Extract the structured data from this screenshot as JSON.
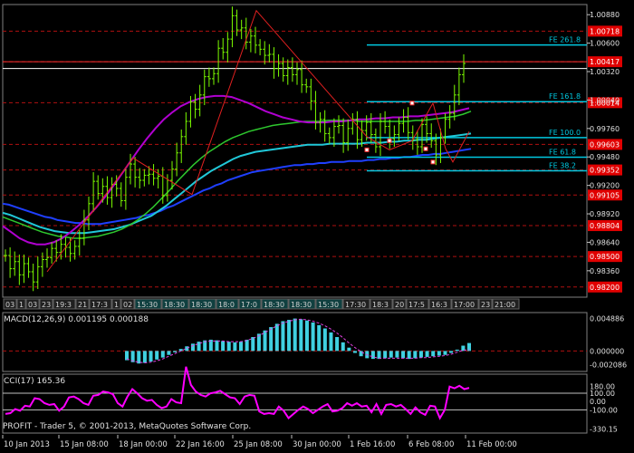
{
  "chart_data": [
    {
      "type": "line",
      "instrument_panel": "price",
      "price_axis_labels": [
        "1.00880",
        "1.00600",
        "1.00320",
        "1.00040",
        "0.99760",
        "0.99480",
        "0.99200",
        "0.98920",
        "0.98640",
        "0.98360"
      ],
      "price_axis_values": [
        1.0088,
        1.006,
        1.0032,
        1.0004,
        0.9976,
        0.9948,
        0.992,
        0.9892,
        0.9864,
        0.9836
      ],
      "ylim": [
        0.981,
        1.0098
      ],
      "level_lines": [
        {
          "label": "1.00718",
          "value": 1.00718
        },
        {
          "label": "1.00417",
          "value": 1.00417
        },
        {
          "label": "1.00014",
          "value": 1.00014
        },
        {
          "label": "0.99603",
          "value": 0.99603
        },
        {
          "label": "0.99352",
          "value": 0.99352
        },
        {
          "label": "0.99105",
          "value": 0.99105
        },
        {
          "label": "0.98804",
          "value": 0.98804
        },
        {
          "label": "0.98500",
          "value": 0.985
        },
        {
          "label": "0.98200",
          "value": 0.982
        }
      ],
      "fibonacci": [
        {
          "label": "FE 261.8",
          "value": 1.00582
        },
        {
          "label": "FE 161.8",
          "value": 1.00024
        },
        {
          "label": "FE 100.0",
          "value": 0.9967
        },
        {
          "label": "FE 61.8",
          "value": 0.99478
        },
        {
          "label": "FE 38.2",
          "value": 0.99344
        }
      ],
      "time_scale_labels": [
        "03",
        "1",
        "03",
        "23",
        "19:3",
        "21",
        "17:3",
        "1",
        "02",
        "15:30",
        "18:30",
        "18:30",
        "18:0",
        "17:0",
        "18:30",
        "18:30",
        "15:30",
        "17:30",
        "18:3",
        "20",
        "17:5",
        "16:3",
        "17:00",
        "23",
        "21:00"
      ],
      "close": [
        0.9851,
        0.9838,
        0.9845,
        0.9832,
        0.9843,
        0.9835,
        0.9825,
        0.984,
        0.9847,
        0.9849,
        0.9858,
        0.9854,
        0.9862,
        0.9859,
        0.9853,
        0.986,
        0.9868,
        0.9886,
        0.9902,
        0.9924,
        0.9912,
        0.9919,
        0.9908,
        0.9921,
        0.9917,
        0.9905,
        0.9928,
        0.9941,
        0.9928,
        0.9925,
        0.993,
        0.9931,
        0.9927,
        0.9929,
        0.991,
        0.9925,
        0.9936,
        0.9952,
        0.9968,
        0.9983,
        1.0002,
        0.9995,
        1.0009,
        1.0027,
        1.0025,
        1.003,
        1.0055,
        1.0051,
        1.0064,
        1.0087,
        1.0073,
        1.0075,
        1.0061,
        1.0067,
        1.0058,
        1.0054,
        1.0048,
        1.0049,
        1.0035,
        1.004,
        1.0028,
        1.0036,
        1.0029,
        1.0034,
        1.0019,
        1.0017,
        1.0003,
        0.9982,
        0.9985,
        0.9971,
        0.9967,
        0.9978,
        0.9979,
        0.9962,
        0.9976,
        0.9985,
        0.9965,
        0.9974,
        0.9982,
        0.997,
        0.9958,
        0.9983,
        0.9978,
        0.9966,
        0.997,
        0.9981,
        0.9987,
        0.9972,
        0.9965,
        0.9958,
        0.998,
        0.9971,
        0.9964,
        0.995,
        0.9967,
        0.9985,
        0.9991,
        1.0009,
        1.0029,
        1.004
      ],
      "ma_blue": [
        0.9902,
        0.9901,
        0.9899,
        0.9897,
        0.9895,
        0.9893,
        0.9891,
        0.9889,
        0.9888,
        0.9886,
        0.9885,
        0.9884,
        0.9883,
        0.9883,
        0.9882,
        0.9882,
        0.9882,
        0.9883,
        0.9884,
        0.9885,
        0.9886,
        0.9887,
        0.9888,
        0.989,
        0.9891,
        0.9893,
        0.9895,
        0.9898,
        0.99,
        0.9903,
        0.9906,
        0.9909,
        0.9912,
        0.9915,
        0.9917,
        0.992,
        0.9922,
        0.9925,
        0.9927,
        0.9929,
        0.9931,
        0.9933,
        0.9934,
        0.9935,
        0.9936,
        0.9937,
        0.9938,
        0.9939,
        0.994,
        0.994,
        0.9941,
        0.9941,
        0.9942,
        0.9942,
        0.9943,
        0.9943,
        0.9943,
        0.9944,
        0.9944,
        0.9944,
        0.9945,
        0.9945,
        0.9946,
        0.9946,
        0.9947,
        0.9947,
        0.9948,
        0.9948,
        0.9949,
        0.995,
        0.995,
        0.9951,
        0.9951,
        0.9952,
        0.9953,
        0.9954,
        0.9955,
        0.9956
      ],
      "ma_cyan": [
        0.9893,
        0.9891,
        0.9888,
        0.9885,
        0.9882,
        0.9879,
        0.9877,
        0.9875,
        0.9874,
        0.9873,
        0.9873,
        0.9873,
        0.9874,
        0.9875,
        0.9876,
        0.9877,
        0.9879,
        0.9881,
        0.9884,
        0.9887,
        0.989,
        0.9895,
        0.99,
        0.9906,
        0.9912,
        0.9918,
        0.9924,
        0.9929,
        0.9934,
        0.9938,
        0.9942,
        0.9946,
        0.9949,
        0.9951,
        0.9953,
        0.9954,
        0.9955,
        0.9956,
        0.9957,
        0.9958,
        0.9959,
        0.996,
        0.996,
        0.996,
        0.9961,
        0.9961,
        0.9961,
        0.9961,
        0.9961,
        0.9962,
        0.9962,
        0.9962,
        0.9963,
        0.9963,
        0.9964,
        0.9964,
        0.9965,
        0.9965,
        0.9966,
        0.9967,
        0.9968,
        0.9969,
        0.997,
        0.9971
      ],
      "ma_green": [
        0.9889,
        0.9886,
        0.9883,
        0.988,
        0.9877,
        0.9874,
        0.9872,
        0.987,
        0.9869,
        0.9868,
        0.9868,
        0.9869,
        0.987,
        0.9872,
        0.9874,
        0.9877,
        0.9881,
        0.9886,
        0.9892,
        0.9899,
        0.9907,
        0.9915,
        0.9924,
        0.9932,
        0.994,
        0.9947,
        0.9953,
        0.9958,
        0.9963,
        0.9967,
        0.997,
        0.9973,
        0.9975,
        0.9977,
        0.9979,
        0.998,
        0.9981,
        0.9982,
        0.9983,
        0.9983,
        0.9983,
        0.9984,
        0.9984,
        0.9984,
        0.9984,
        0.9983,
        0.9983,
        0.9983,
        0.9983,
        0.9983,
        0.9983,
        0.9983,
        0.9984,
        0.9984,
        0.9985,
        0.9986,
        0.9987,
        0.9988,
        0.999,
        0.9993
      ],
      "ma_purple": [
        0.988,
        0.9874,
        0.9868,
        0.9864,
        0.9862,
        0.9862,
        0.9864,
        0.9868,
        0.9874,
        0.9881,
        0.9889,
        0.9898,
        0.9908,
        0.9919,
        0.9931,
        0.9943,
        0.9955,
        0.9966,
        0.9976,
        0.9985,
        0.9992,
        0.9998,
        1.0002,
        1.0005,
        1.0007,
        1.0008,
        1.0008,
        1.0007,
        1.0004,
        1.0001,
        0.9997,
        0.9993,
        0.999,
        0.9987,
        0.9985,
        0.9983,
        0.9982,
        0.9982,
        0.9982,
        0.9983,
        0.9983,
        0.9984,
        0.9985,
        0.9985,
        0.9986,
        0.9986,
        0.9987,
        0.9987,
        0.9988,
        0.9988,
        0.9989,
        0.999,
        0.9991,
        0.9992,
        0.9994,
        0.9996
      ],
      "zigzag": [
        0.9835,
        0.9947,
        0.9911,
        1.0092,
        0.9968,
        0.9955,
        0.9964,
        1.0001,
        0.9956,
        0.9943,
        0.9973
      ],
      "swing_points": [
        0.9955,
        0.9964,
        1.0001,
        0.9956,
        0.9943
      ]
    },
    {
      "type": "bar",
      "title": "MACD(12,26,9) 0.001195 0.000188",
      "axis_labels": [
        "0.004886",
        "0.000000",
        "-0.002086"
      ],
      "ylim": [
        -0.0031,
        0.0058
      ],
      "values": [
        -0.0014,
        -0.0017,
        -0.0019,
        -0.0018,
        -0.0016,
        -0.0013,
        -0.001,
        -0.0006,
        -0.0002,
        0.0003,
        0.0007,
        0.0011,
        0.0014,
        0.0016,
        0.0017,
        0.0016,
        0.0015,
        0.0014,
        0.0013,
        0.0014,
        0.0017,
        0.0021,
        0.0026,
        0.0031,
        0.0036,
        0.0041,
        0.0045,
        0.0047,
        0.0049,
        0.0048,
        0.0046,
        0.0043,
        0.0039,
        0.0034,
        0.0028,
        0.0021,
        0.0013,
        0.0005,
        -0.0003,
        -0.0008,
        -0.0011,
        -0.0012,
        -0.0012,
        -0.0011,
        -0.001,
        -0.001,
        -0.0011,
        -0.0012,
        -0.0011,
        -0.001,
        -0.0009,
        -0.0008,
        -0.0007,
        -0.0006,
        -0.0003,
        0.0002,
        0.0008,
        0.0012
      ],
      "signal": [
        -0.0012,
        -0.0015,
        -0.0017,
        -0.0018,
        -0.0017,
        -0.0015,
        -0.0012,
        -0.0008,
        -0.0004,
        0.0,
        0.0004,
        0.0008,
        0.0011,
        0.0014,
        0.0015,
        0.0015,
        0.0015,
        0.0014,
        0.0014,
        0.0014,
        0.0016,
        0.0019,
        0.0023,
        0.0028,
        0.0033,
        0.0038,
        0.0042,
        0.0045,
        0.0047,
        0.0048,
        0.0047,
        0.0045,
        0.0042,
        0.0038,
        0.0033,
        0.0027,
        0.002,
        0.0012,
        0.0005,
        -0.0001,
        -0.0006,
        -0.0009,
        -0.0011,
        -0.0011,
        -0.0011,
        -0.0011,
        -0.0011,
        -0.0011,
        -0.0011,
        -0.001,
        -0.001,
        -0.0009,
        -0.0008,
        -0.0007,
        -0.0005,
        -0.0002,
        0.0001,
        0.0002
      ]
    },
    {
      "type": "line",
      "title": "CCI(17) 165.36",
      "axis_labels": [
        "180.00",
        "100.00",
        "0.00",
        "-100.00",
        "-330.15"
      ],
      "ylim": [
        -380,
        330
      ],
      "values": [
        -150,
        -140,
        -90,
        -110,
        -50,
        -60,
        40,
        30,
        -20,
        -40,
        -30,
        -110,
        -60,
        50,
        60,
        30,
        -20,
        -40,
        70,
        80,
        120,
        110,
        90,
        -20,
        -60,
        60,
        150,
        100,
        40,
        10,
        20,
        -40,
        -80,
        -60,
        30,
        -10,
        -20,
        420,
        200,
        120,
        80,
        60,
        100,
        110,
        130,
        90,
        50,
        40,
        -30,
        60,
        80,
        70,
        -120,
        -150,
        -140,
        -150,
        -60,
        -110,
        -200,
        -150,
        -100,
        -60,
        -90,
        -140,
        -100,
        -60,
        -30,
        -120,
        -110,
        -80,
        -20,
        -50,
        -20,
        -60,
        -50,
        -130,
        -30,
        -150,
        -40,
        -30,
        -60,
        -40,
        -90,
        -150,
        -70,
        -130,
        -160,
        -50,
        -60,
        -200,
        -100,
        180,
        160,
        190,
        150,
        165
      ]
    }
  ],
  "time_axis": {
    "labels": [
      "10 Jan 2013",
      "15 Jan 08:00",
      "18 Jan 00:00",
      "22 Jan 16:00",
      "25 Jan 08:00",
      "30 Jan 00:00",
      "1 Feb 16:00",
      "6 Feb 08:00",
      "11 Feb 00:00"
    ]
  },
  "footer": {
    "copyright": "PROFIT - Trader 5, © 2001-2013, MetaQuotes Software Corp."
  },
  "colors": {
    "background": "#000000",
    "grid": "#b01010",
    "candles": "#7cfc00",
    "ma_blue": "#1f3fff",
    "ma_cyan": "#20c8d8",
    "ma_green": "#2ec82e",
    "ma_purple": "#b000d0",
    "fib": "#00c8e0",
    "zigzag": "#e02020",
    "macd_histogram": "#40d0e0",
    "macd_signal": "#e040e0",
    "cci": "#ff00ff",
    "price_tag": "#e00000",
    "text": "#e0e0e0"
  }
}
